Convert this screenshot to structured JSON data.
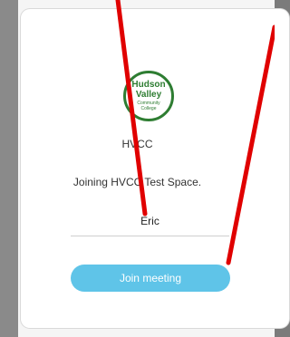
{
  "logo": {
    "line1": "Hudson",
    "line2": "Valley",
    "line3": "Community",
    "line4": "College",
    "color": "#2e7d32",
    "icon": "hvcc-logo-icon"
  },
  "org_name": "HVCC",
  "joining_text": "Joining HVCC Test Space.",
  "name_field": {
    "value": "Eric"
  },
  "join_button": {
    "label": "Join meeting",
    "color": "#5fc4e8"
  },
  "annotation": {
    "color": "#e00000"
  }
}
